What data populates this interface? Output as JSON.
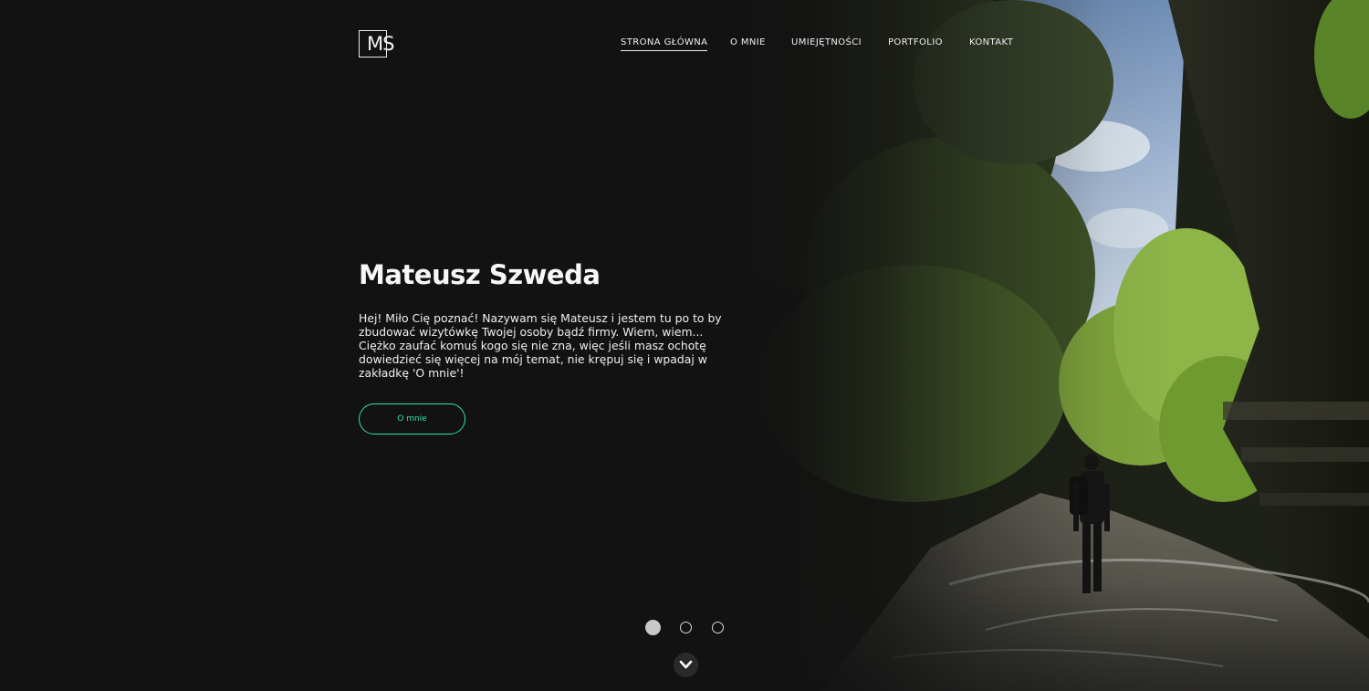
{
  "logo": {
    "text": "MS"
  },
  "nav": {
    "items": [
      {
        "label": "STRONA GŁÓWNA",
        "active": true
      },
      {
        "label": "O MNIE",
        "active": false
      },
      {
        "label": "UMIEJĘTNOŚCI",
        "active": false
      },
      {
        "label": "PORTFOLIO",
        "active": false
      },
      {
        "label": "KONTAKT",
        "active": false
      }
    ]
  },
  "hero": {
    "title": "Mateusz Szweda",
    "text": "Hej! Miło Cię poznać! Nazywam się Mateusz i jestem tu po to by zbudować wizytówkę Twojej osoby bądź firmy. Wiem, wiem... Ciężko zaufać komuś kogo się nie zna, więc jeśli masz ochotę dowiedzieć się więcej na mój temat, nie krępuj się i wpadaj w zakładkę 'O mnie'!",
    "button_label": "O mnie"
  },
  "slider": {
    "slide_count": 3,
    "active_index": 0
  },
  "scroll_down": {
    "icon": "chevron-down-icon"
  },
  "colors": {
    "background": "#121212",
    "accent": "#2ee6a0",
    "text": "#f0f0f0"
  }
}
